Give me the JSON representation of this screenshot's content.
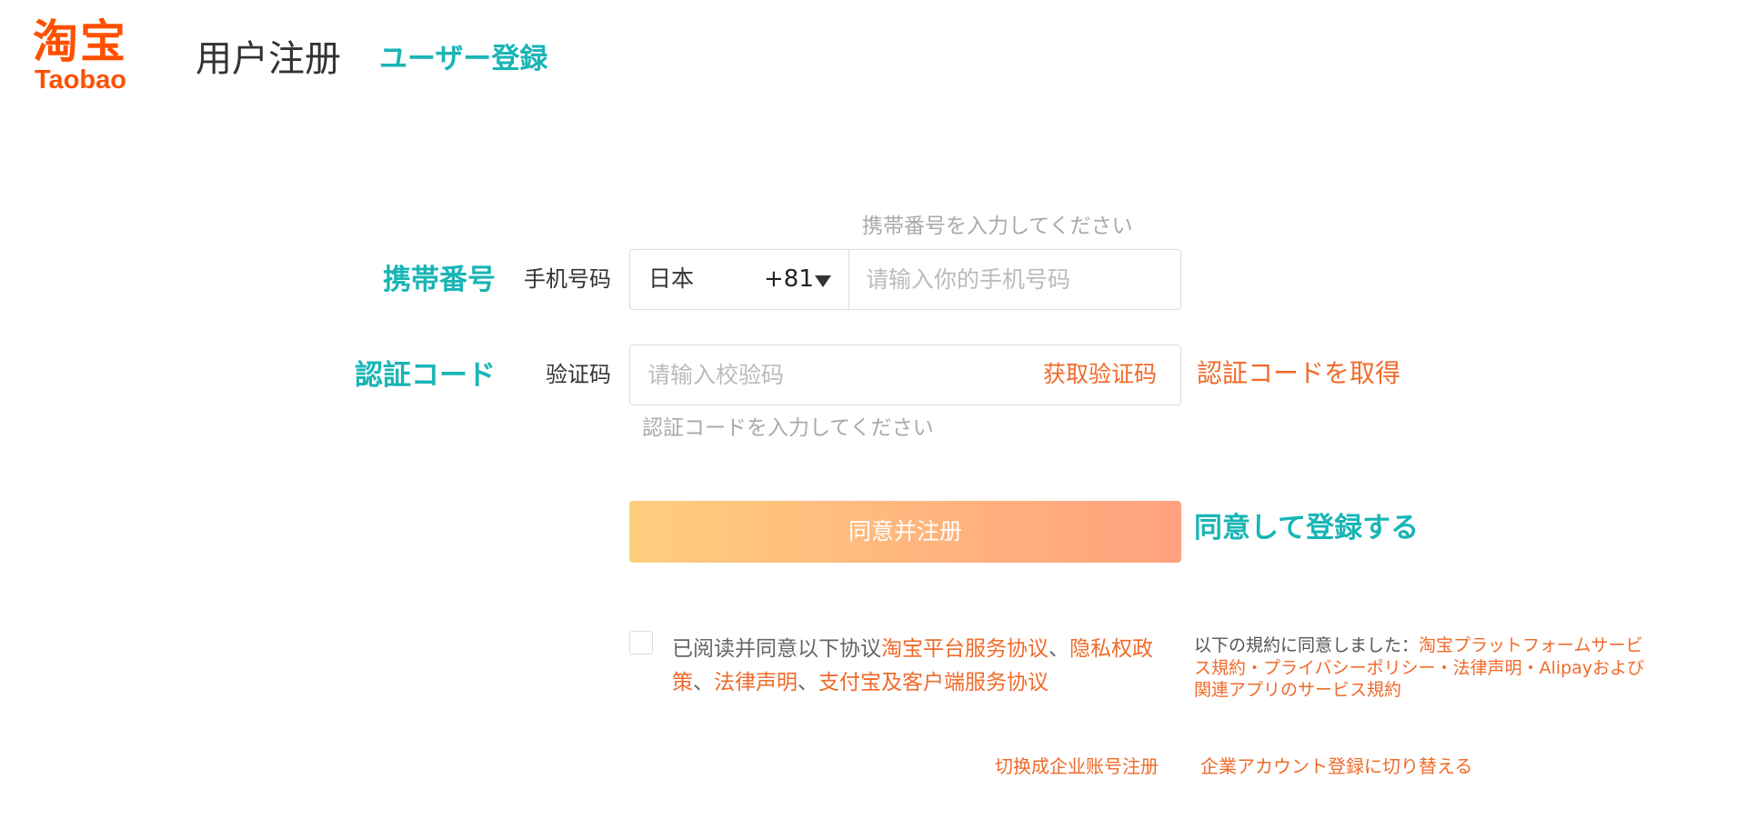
{
  "header": {
    "logo_cn": "淘宝",
    "logo_en": "Taobao",
    "title": "用户注册",
    "title_jp": "ユーザー登録"
  },
  "phone": {
    "label_jp": "携帯番号",
    "label": "手机号码",
    "hint": "携帯番号を入力してください",
    "country": "日本",
    "code": "+81",
    "placeholder": "请输入你的手机号码"
  },
  "verify": {
    "label_jp": "認証コード",
    "label": "验证码",
    "placeholder": "请输入校验码",
    "get_code": "获取验证码",
    "get_code_jp": "認証コードを取得",
    "hint": "認証コードを入力してください"
  },
  "submit": {
    "label": "同意并注册",
    "label_jp": "同意して登録する"
  },
  "agreement": {
    "checked": false,
    "prefix": "已阅读并同意以下协议",
    "link1": "淘宝平台服务协议",
    "sep1": "、",
    "link2": "隐私权政策",
    "sep2": "、",
    "link3": "法律声明",
    "sep3": "、",
    "link4": "支付宝及客户端服务协议",
    "jp_prefix": "以下の規約に同意しました：",
    "jp_terms": "淘宝プラットフォームサービス規約・プライバシーポリシー・法律声明・Alipayおよび関連アプリのサービス規約"
  },
  "switch": {
    "label": "切换成企业账号注册",
    "label_jp": "企業アカウント登録に切り替える"
  },
  "colors": {
    "brand": "#ff5000",
    "accent_teal": "#19b5b5",
    "link_orange": "#f06a2a"
  }
}
